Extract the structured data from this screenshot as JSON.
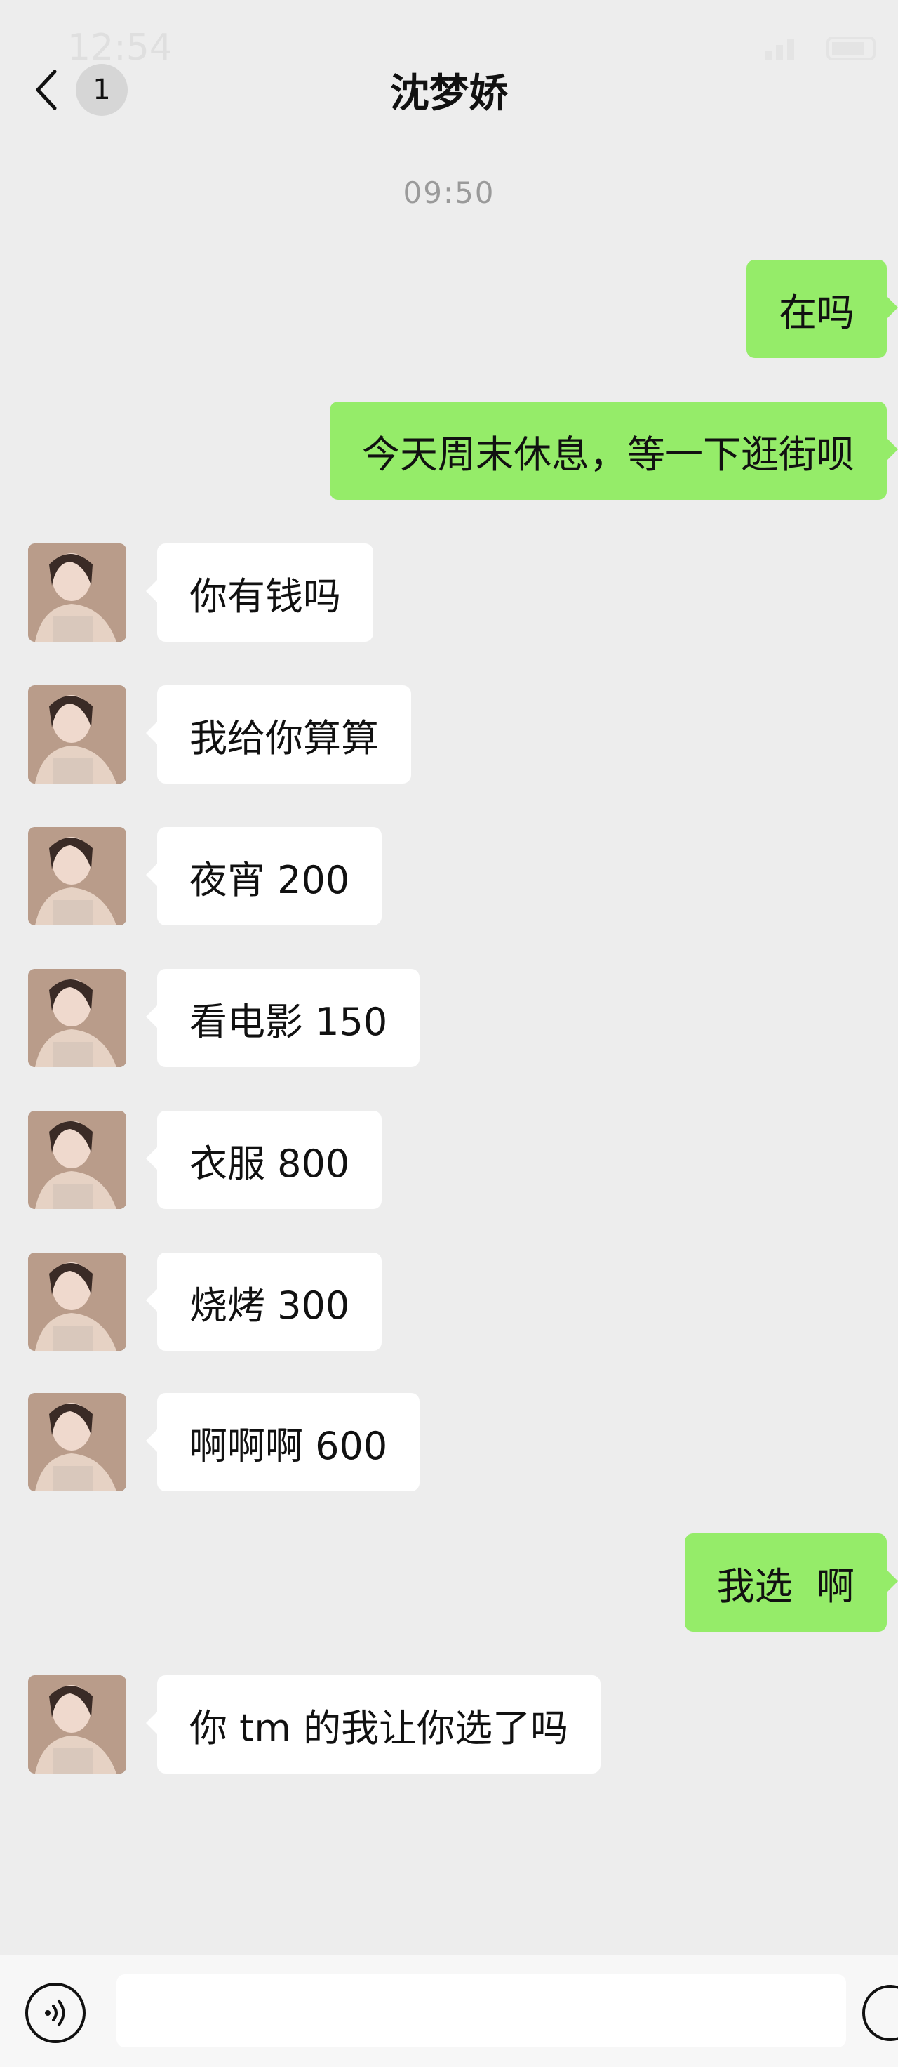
{
  "status_bar": {
    "time": "12:54"
  },
  "header": {
    "back_badge": "1",
    "title": "沈梦娇"
  },
  "timestamp": "09:50",
  "messages": [
    {
      "side": "sent",
      "text": "在吗"
    },
    {
      "side": "sent",
      "text": "今天周末休息，等一下逛街呗"
    },
    {
      "side": "recv",
      "text": "你有钱吗"
    },
    {
      "side": "recv",
      "text": "我给你算算"
    },
    {
      "side": "recv",
      "text": "夜宵 200"
    },
    {
      "side": "recv",
      "text": "看电影 150"
    },
    {
      "side": "recv",
      "text": "衣服 800"
    },
    {
      "side": "recv",
      "text": "烧烤 300"
    },
    {
      "side": "recv",
      "text": "啊啊啊 600"
    },
    {
      "side": "sent",
      "text": "我选  啊"
    },
    {
      "side": "recv",
      "text": "你 tm 的我让你选了吗"
    }
  ],
  "input_bar": {
    "voice_icon": "voice-icon",
    "emoji_icon": "emoji-icon",
    "input_value": ""
  },
  "colors": {
    "background": "#ededed",
    "sent_bubble": "#95ec69",
    "recv_bubble": "#ffffff"
  }
}
